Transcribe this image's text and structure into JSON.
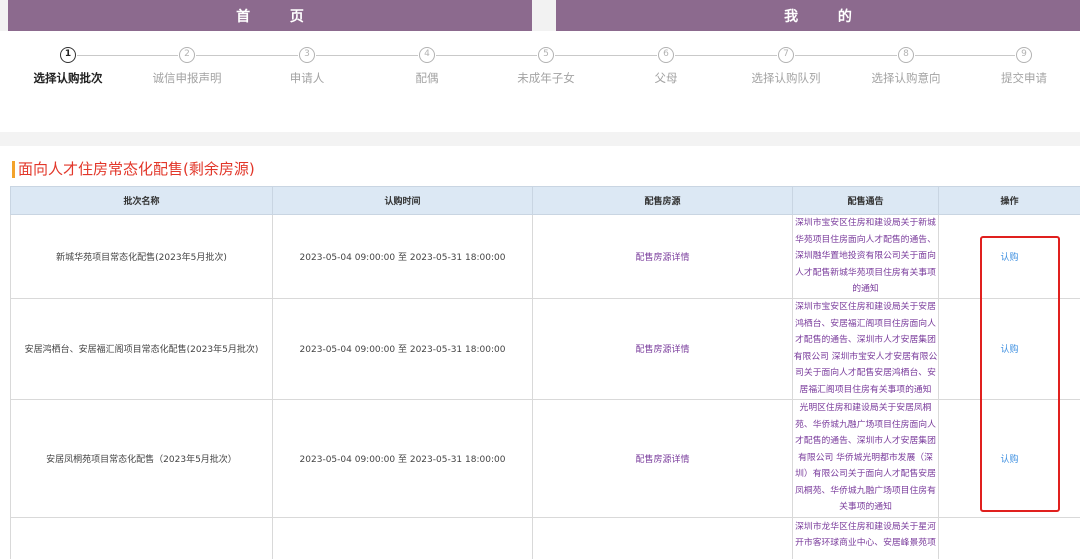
{
  "nav": {
    "home_label": "首 页",
    "mine_label": "我 的"
  },
  "current_step": 1,
  "steps": [
    {
      "number": "1",
      "label": "选择认购批次"
    },
    {
      "number": "2",
      "label": "诚信申报声明"
    },
    {
      "number": "3",
      "label": "申请人"
    },
    {
      "number": "4",
      "label": "配偶"
    },
    {
      "number": "5",
      "label": "未成年子女"
    },
    {
      "number": "6",
      "label": "父母"
    },
    {
      "number": "7",
      "label": "选择认购队列"
    },
    {
      "number": "8",
      "label": "选择认购意向"
    },
    {
      "number": "9",
      "label": "提交申请"
    }
  ],
  "section": {
    "title": "面向人才住房常态化配售(剩余房源)"
  },
  "table": {
    "headers": [
      "批次名称",
      "认购时间",
      "配售房源",
      "配售通告",
      "操作"
    ],
    "rows": [
      {
        "name": "新城华苑项目常态化配售(2023年5月批次)",
        "time": "2023-05-04 09:00:00 至 2023-05-31 18:00:00",
        "housing_link": "配售房源详情",
        "notice_lines": [
          "深圳市宝安区住房和建设局关于新城",
          "华苑项目住房面向人才配售的通告、",
          "深圳融华置地投资有限公司关于面向",
          "人才配售新城华苑项目住房有关事项",
          "的通知"
        ],
        "action": "认购"
      },
      {
        "name": "安居鸿栖台、安居福汇阁项目常态化配售(2023年5月批次)",
        "time": "2023-05-04 09:00:00 至 2023-05-31 18:00:00",
        "housing_link": "配售房源详情",
        "notice_lines": [
          "深圳市宝安区住房和建设局关于安居",
          "鸿栖台、安居福汇阁项目住房面向人",
          "才配售的通告、深圳市人才安居集团",
          "有限公司 深圳市宝安人才安居有限公",
          "司关于面向人才配售安居鸿栖台、安",
          "居福汇阁项目住房有关事项的通知"
        ],
        "action": "认购"
      },
      {
        "name": "安居凤桐苑项目常态化配售（2023年5月批次）",
        "time": "2023-05-04 09:00:00 至 2023-05-31 18:00:00",
        "housing_link": "配售房源详情",
        "notice_lines": [
          "光明区住房和建设局关于安居凤桐",
          "苑、华侨城九融广场项目住房面向人",
          "才配售的通告、深圳市人才安居集团",
          "有限公司 华侨城光明都市发展（深",
          "圳）有限公司关于面向人才配售安居",
          "凤桐苑、华侨城九融广场项目住房有",
          "关事项的通知"
        ],
        "action": "认购"
      },
      {
        "notice_lines": [
          "深圳市龙华区住房和建设局关于星河",
          "开市客环球商业中心、安居峰景苑项"
        ]
      }
    ]
  },
  "colors": {
    "nav-purple": "#8c6a8e",
    "section-title-red": "#e2372a",
    "section-bar-orange": "#f3a32b",
    "header-bg": "#dce8f4",
    "link-purple": "#7a3c9c",
    "action-blue": "#3d8fe0",
    "highlight-red": "#e0201e"
  }
}
